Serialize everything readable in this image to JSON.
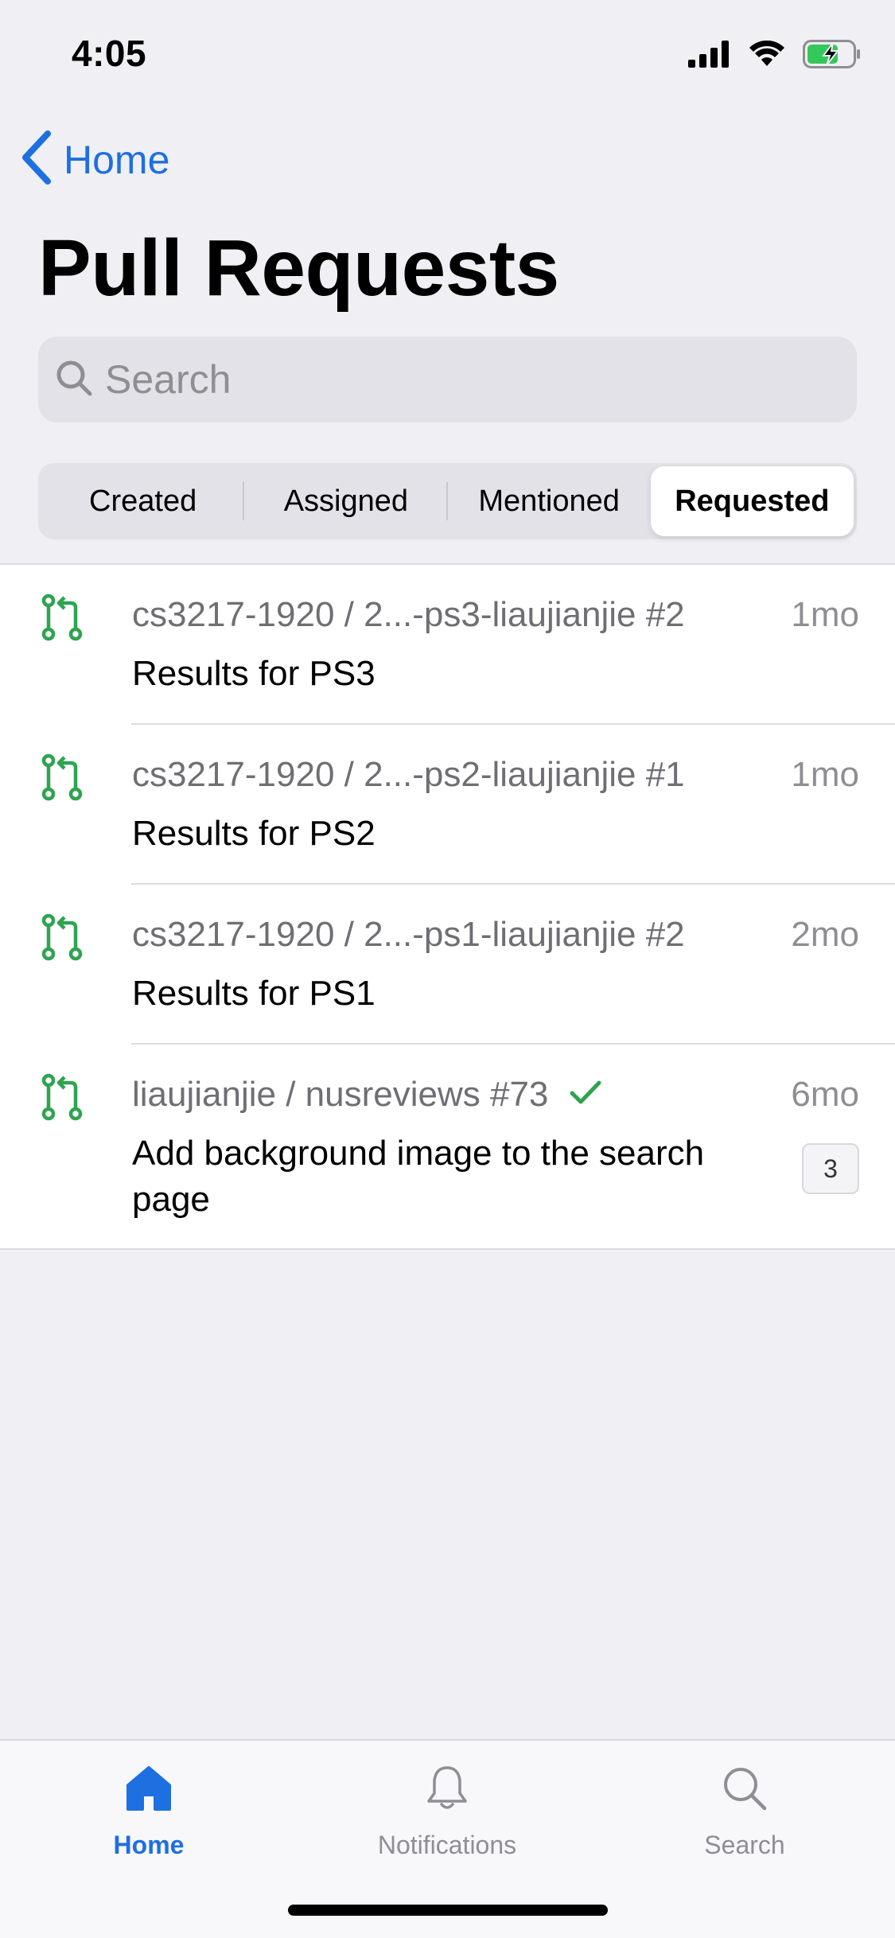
{
  "status_bar": {
    "time": "4:05",
    "icons": [
      "signal-icon",
      "wifi-icon",
      "battery-charging-icon"
    ]
  },
  "nav": {
    "back_label": "Home",
    "title": "Pull Requests"
  },
  "search": {
    "placeholder": "Search"
  },
  "segments": {
    "items": [
      "Created",
      "Assigned",
      "Mentioned",
      "Requested"
    ],
    "selected": "Requested"
  },
  "pull_requests": [
    {
      "repo": "cs3217-1920 / 2...-ps3-liaujianjie #2",
      "title": "Results for PS3",
      "age": "1mo"
    },
    {
      "repo": "cs3217-1920 / 2...-ps2-liaujianjie #1",
      "title": "Results for PS2",
      "age": "1mo"
    },
    {
      "repo": "cs3217-1920 / 2...-ps1-liaujianjie #2",
      "title": "Results for PS1",
      "age": "2mo"
    },
    {
      "repo": "liaujianjie / nusreviews #73",
      "title": "Add background image to the search page",
      "age": "6mo",
      "status": "check-icon",
      "comments": "3"
    }
  ],
  "tab_bar": {
    "items": [
      {
        "label": "Home",
        "icon": "home-icon"
      },
      {
        "label": "Notifications",
        "icon": "bell-icon"
      },
      {
        "label": "Search",
        "icon": "search-icon"
      }
    ],
    "active": "Home"
  },
  "colors": {
    "accent": "#1e6fe0",
    "pr_open": "#2ea44f",
    "background": "#efeff4"
  }
}
